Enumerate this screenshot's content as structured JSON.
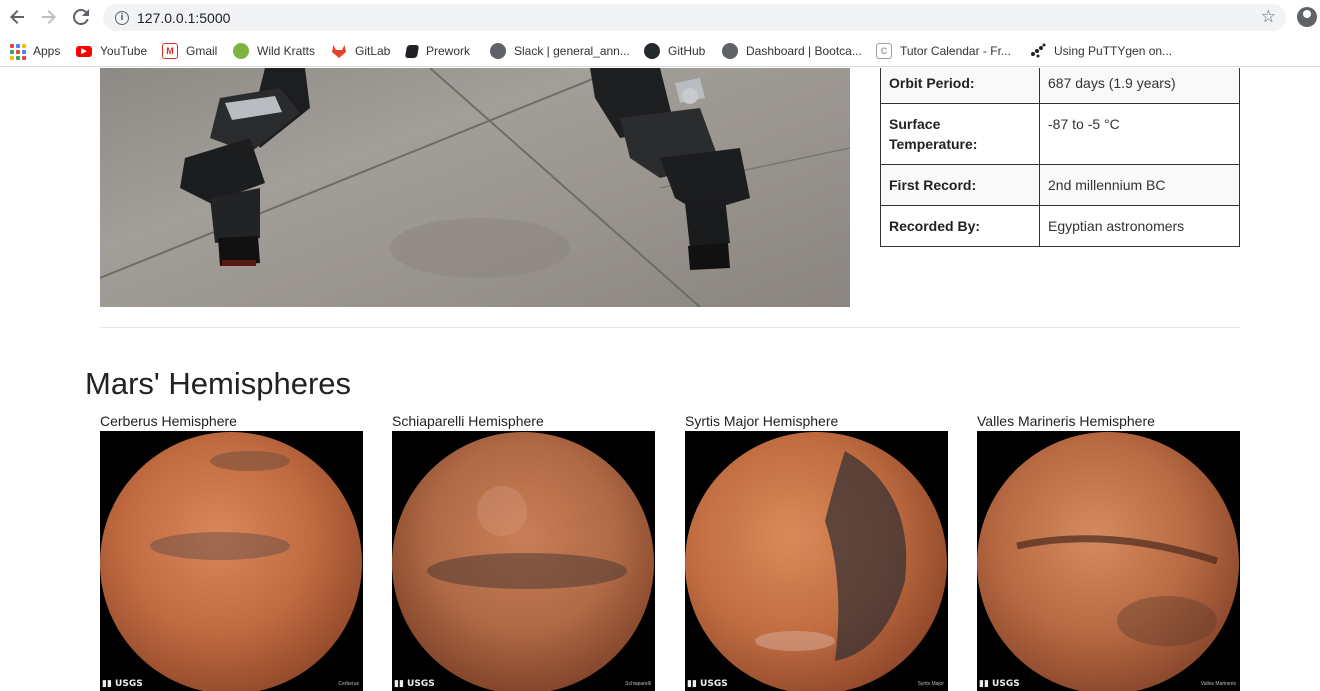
{
  "browser": {
    "url": "127.0.0.1:5000",
    "bookmarks": [
      {
        "label": "Apps",
        "icon": "apps-grid-icon"
      },
      {
        "label": "YouTube",
        "icon": "youtube-icon",
        "color": "#ff0000"
      },
      {
        "label": "Gmail",
        "icon": "gmail-icon",
        "color": "#d93025"
      },
      {
        "label": "Wild Kratts",
        "icon": "wild-kratts-icon",
        "color": "#7cb342"
      },
      {
        "label": "GitLab",
        "icon": "gitlab-icon",
        "color": "#e24329"
      },
      {
        "label": "Prework",
        "icon": "book-icon",
        "color": "#202124"
      },
      {
        "label": "Slack | general_ann...",
        "icon": "globe-icon",
        "color": "#5f6368"
      },
      {
        "label": "GitHub",
        "icon": "github-icon",
        "color": "#24292e"
      },
      {
        "label": "Dashboard | Bootca...",
        "icon": "globe-icon",
        "color": "#5f6368"
      },
      {
        "label": "Tutor Calendar - Fr...",
        "icon": "calendar-icon",
        "color": "#9aa0a6"
      },
      {
        "label": "Using PuTTYgen on...",
        "icon": "puttygen-icon",
        "color": "#202124"
      }
    ]
  },
  "facts": [
    {
      "label": "Orbit Period:",
      "value": "687 days (1.9 years)"
    },
    {
      "label": "Surface Temperature:",
      "value": "-87 to -5 °C"
    },
    {
      "label": "First Record:",
      "value": "2nd millennium BC"
    },
    {
      "label": "Recorded By:",
      "value": "Egyptian astronomers"
    }
  ],
  "hemispheres": {
    "title": "Mars' Hemispheres",
    "items": [
      {
        "title": "Cerberus Hemisphere",
        "credit": "USGS",
        "tag": "Cerberus"
      },
      {
        "title": "Schiaparelli Hemisphere",
        "credit": "USGS",
        "tag": "Schiaparelli"
      },
      {
        "title": "Syrtis Major Hemisphere",
        "credit": "USGS",
        "tag": "Syrtis Major"
      },
      {
        "title": "Valles Marineris Hemisphere",
        "credit": "USGS",
        "tag": "Valles Marineris"
      }
    ]
  }
}
